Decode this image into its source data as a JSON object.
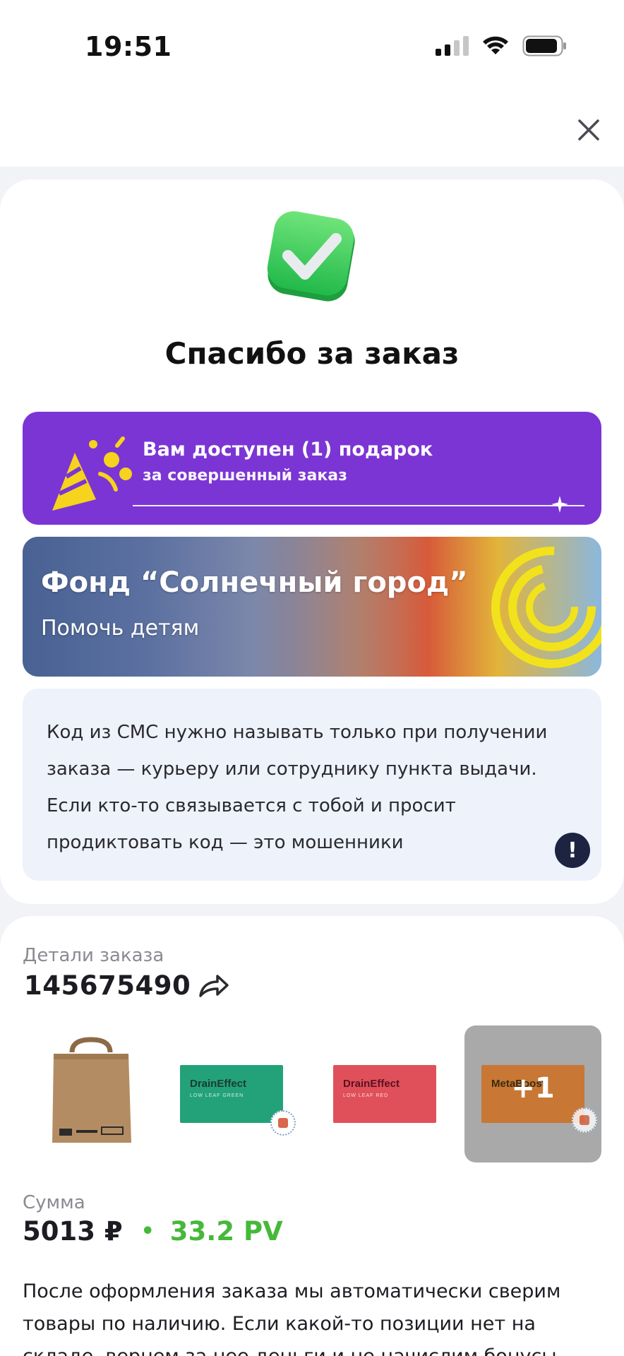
{
  "status_bar": {
    "time": "19:51"
  },
  "header": {
    "close_icon": "close-icon"
  },
  "success": {
    "icon": "check-icon",
    "title": "Спасибо за заказ"
  },
  "gift_banner": {
    "title": "Вам доступен (1) подарок",
    "subtitle": "за совершенный заказ",
    "color": "#7b35d4"
  },
  "fund_banner": {
    "title": "Фонд “Солнечный город”",
    "subtitle": "Помочь детям"
  },
  "notice": {
    "text": "Код из СМС нужно называть только при получении заказа — курьеру или сотруднику пункта выдачи. Если кто-то связывается с тобой и просит продиктовать код — это мошенники",
    "icon": "!"
  },
  "order": {
    "label": "Детали заказа",
    "number": "145675490",
    "products": [
      {
        "name": "paper-bag",
        "label": ""
      },
      {
        "name": "draineffect-green",
        "label": "DrainEffect",
        "sub": "LOW LEAF GREEN"
      },
      {
        "name": "draineffect-red",
        "label": "DrainEffect",
        "sub": "LOW LEAF RED"
      },
      {
        "name": "metaboost",
        "label": "MetaBoost",
        "more": "+1"
      }
    ]
  },
  "sum": {
    "label": "Сумма",
    "value": "5013 ₽",
    "dot": "•",
    "pv": "33.2 PV",
    "pv_color": "#46b83a"
  },
  "info_text": "После оформления заказа мы автоматически сверим товары по наличию. Если какой-то позиции нет на складе, вернем за нее деньги и не начислим бонусы. Итоговый"
}
